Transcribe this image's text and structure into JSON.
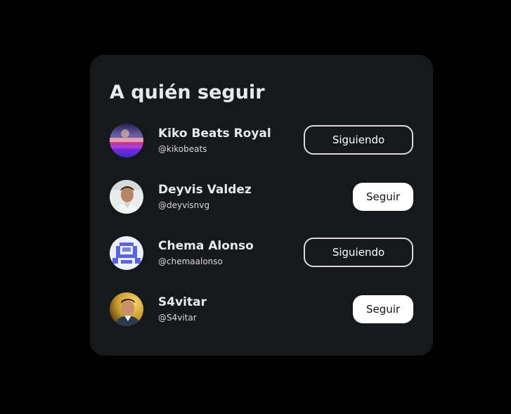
{
  "card": {
    "title": "A quién seguir"
  },
  "users": [
    {
      "name": "Kiko Beats Royal",
      "handle": "@kikobeats",
      "button": "Siguiendo",
      "state": "following",
      "avatar_icon": "kiko-avatar"
    },
    {
      "name": "Deyvis Valdez",
      "handle": "@deyvisnvg",
      "button": "Seguir",
      "state": "follow",
      "avatar_icon": "deyvis-avatar"
    },
    {
      "name": "Chema Alonso",
      "handle": "@chemaalonso",
      "button": "Siguiendo",
      "state": "following",
      "avatar_icon": "chema-avatar"
    },
    {
      "name": "S4vitar",
      "handle": "@S4vitar",
      "button": "Seguir",
      "state": "follow",
      "avatar_icon": "s4vitar-avatar"
    }
  ],
  "colors": {
    "page_background": "#000000",
    "card_background": "#16181c",
    "text_primary": "#e7e9ea",
    "follow_button_bg": "#ffffff"
  }
}
